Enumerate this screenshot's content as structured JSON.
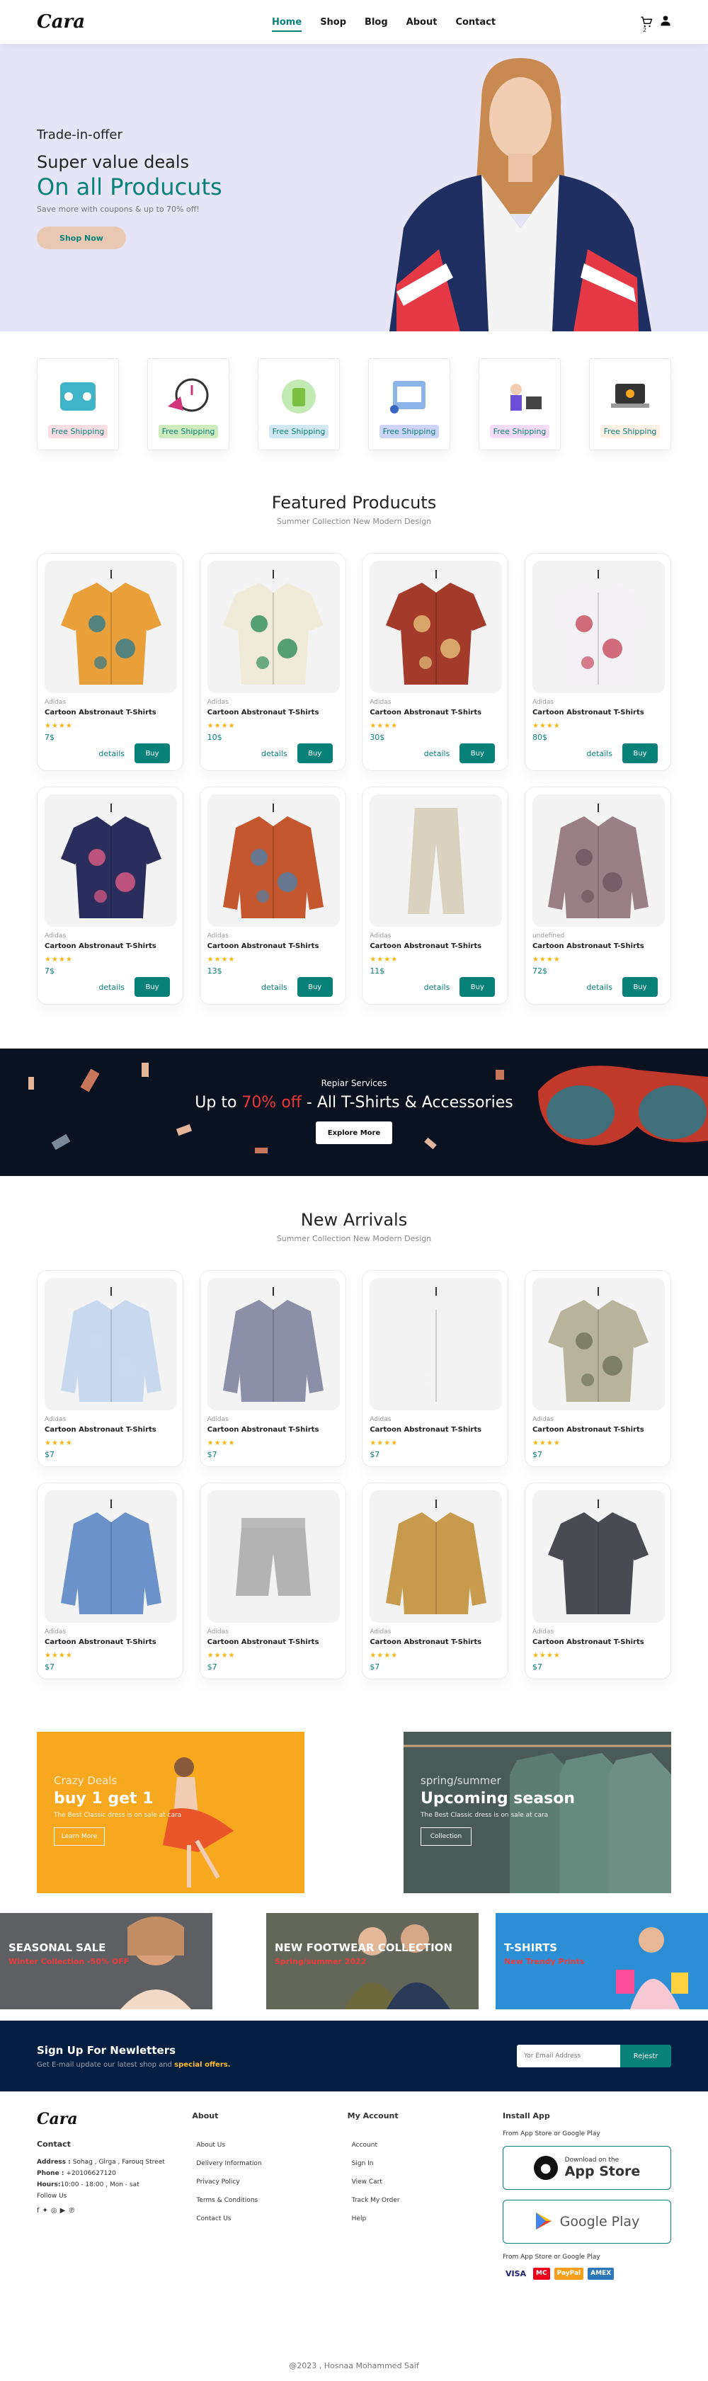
{
  "header": {
    "logo": "Cara",
    "nav": [
      "Home",
      "Shop",
      "Blog",
      "About",
      "Contact"
    ],
    "cart_count": "2"
  },
  "hero": {
    "eyebrow": "Trade-in-offer",
    "title": "Super value deals",
    "highlight": "On all Producuts",
    "subtitle": "Save more with coupons & up to 70% off!",
    "button": "Shop Now"
  },
  "features": [
    {
      "label": "Free Shipping",
      "color": "#fddde4"
    },
    {
      "label": "Free Shipping",
      "color": "#cdebbc"
    },
    {
      "label": "Free Shipping",
      "color": "#d1e8f2"
    },
    {
      "label": "Free Shipping",
      "color": "#cdd4f8"
    },
    {
      "label": "Free Shipping",
      "color": "#f6dbf6"
    },
    {
      "label": "Free Shipping",
      "color": "#fff2e5"
    }
  ],
  "featured": {
    "title": "Featured Producuts",
    "subtitle": "Summer Collection New Modern Design",
    "details": "details",
    "buy": "Buy",
    "products": [
      {
        "brand": "Adidas",
        "name": "Cartoon Abstronaut T-Shirts",
        "stars": "★★★★",
        "price": "7$"
      },
      {
        "brand": "Adidas",
        "name": "Cartoon Abstronaut T-Shirts",
        "stars": "★★★★",
        "price": "10$"
      },
      {
        "brand": "Adidas",
        "name": "Cartoon Abstronaut T-Shirts",
        "stars": "★★★★",
        "price": "30$"
      },
      {
        "brand": "Adidas",
        "name": "Cartoon Abstronaut T-Shirts",
        "stars": "★★★★",
        "price": "80$"
      },
      {
        "brand": "Adidas",
        "name": "Cartoon Abstronaut T-Shirts",
        "stars": "★★★★",
        "price": "7$"
      },
      {
        "brand": "Adidas",
        "name": "Cartoon Abstronaut T-Shirts",
        "stars": "★★★★",
        "price": "13$"
      },
      {
        "brand": "Adidas",
        "name": "Cartoon Abstronaut T-Shirts",
        "stars": "★★★★",
        "price": "11$"
      },
      {
        "brand": "undefined",
        "name": "Cartoon Abstronaut T-Shirts",
        "stars": "★★★★",
        "price": "72$"
      }
    ]
  },
  "banner": {
    "eyebrow": "Repiar Services",
    "pre": "Up to ",
    "red": "70% off",
    "post": " - All T-Shirts & Accessories",
    "button": "Explore More"
  },
  "arrivals": {
    "title": "New Arrivals",
    "subtitle": "Summer Collection New Modern Design",
    "products": [
      {
        "brand": "Adidas",
        "name": "Cartoon Abstronaut T-Shirts",
        "stars": "★★★★",
        "price": "$7"
      },
      {
        "brand": "Adidas",
        "name": "Cartoon Abstronaut T-Shirts",
        "stars": "★★★★",
        "price": "$7"
      },
      {
        "brand": "Adidas",
        "name": "Cartoon Abstronaut T-Shirts",
        "stars": "★★★★",
        "price": "$7"
      },
      {
        "brand": "Adidas",
        "name": "Cartoon Abstronaut T-Shirts",
        "stars": "★★★★",
        "price": "$7"
      },
      {
        "brand": "Adidas",
        "name": "Cartoon Abstronaut T-Shirts",
        "stars": "★★★★",
        "price": "$7"
      },
      {
        "brand": "Adidas",
        "name": "Cartoon Abstronaut T-Shirts",
        "stars": "★★★★",
        "price": "$7"
      },
      {
        "brand": "Adidas",
        "name": "Cartoon Abstronaut T-Shirts",
        "stars": "★★★★",
        "price": "$7"
      },
      {
        "brand": "Adidas",
        "name": "Cartoon Abstronaut T-Shirts",
        "stars": "★★★★",
        "price": "$7"
      }
    ]
  },
  "promo": [
    {
      "eyebrow": "Crazy Deals",
      "title": "buy 1 get 1",
      "text": "The Best Classic dress is on sale at cara",
      "button": "Learn More"
    },
    {
      "eyebrow": "spring/summer",
      "title": "Upcoming season",
      "text": "The Best Classic dress is on sale at cara",
      "button": "Collection"
    }
  ],
  "three": [
    {
      "title": "SEASONAL SALE",
      "sub": "Winter Collection -50% OFF"
    },
    {
      "title": "NEW FOOTWEAR COLLECTION",
      "sub": "Spring/summer 2022"
    },
    {
      "title": "T-SHIRTS",
      "sub": "New Trendy Prints"
    }
  ],
  "newsletter": {
    "title": "Sign Up For Newletters",
    "text": "Get E-mail update our latest shop and ",
    "highlight": "special offers.",
    "placeholder": "Yor Email Address",
    "button": "Rejestr"
  },
  "footer": {
    "contact": {
      "title": "Contact",
      "address_label": "Address :",
      "address": " Sohag , Girga , Farouq Street",
      "phone_label": "Phone :",
      "phone": " +20106627120",
      "hours_label": "Hours:",
      "hours": "10:00 - 18:00 , Mon - sat",
      "follow": "Follow Us"
    },
    "about": {
      "title": "About",
      "links": [
        "About Us",
        "Delivery Information",
        "Privacy Policy",
        "Terms & Conditions",
        "Contact Us"
      ]
    },
    "account": {
      "title": "My Account",
      "links": [
        "Account",
        "Sign In",
        "View Cart",
        "Track My Order",
        "Help"
      ]
    },
    "app": {
      "title": "Install App",
      "from": "From App Store or Google Play",
      "apple_small": "Download on the",
      "apple_big": "App Store",
      "google": "Google Play",
      "from2": "From App Store or Google Play",
      "cards": [
        "VISA",
        "MC",
        "PayPal",
        "AMEX"
      ]
    }
  },
  "copyright": "@2023 , Hosnaa Mohammed Saif"
}
